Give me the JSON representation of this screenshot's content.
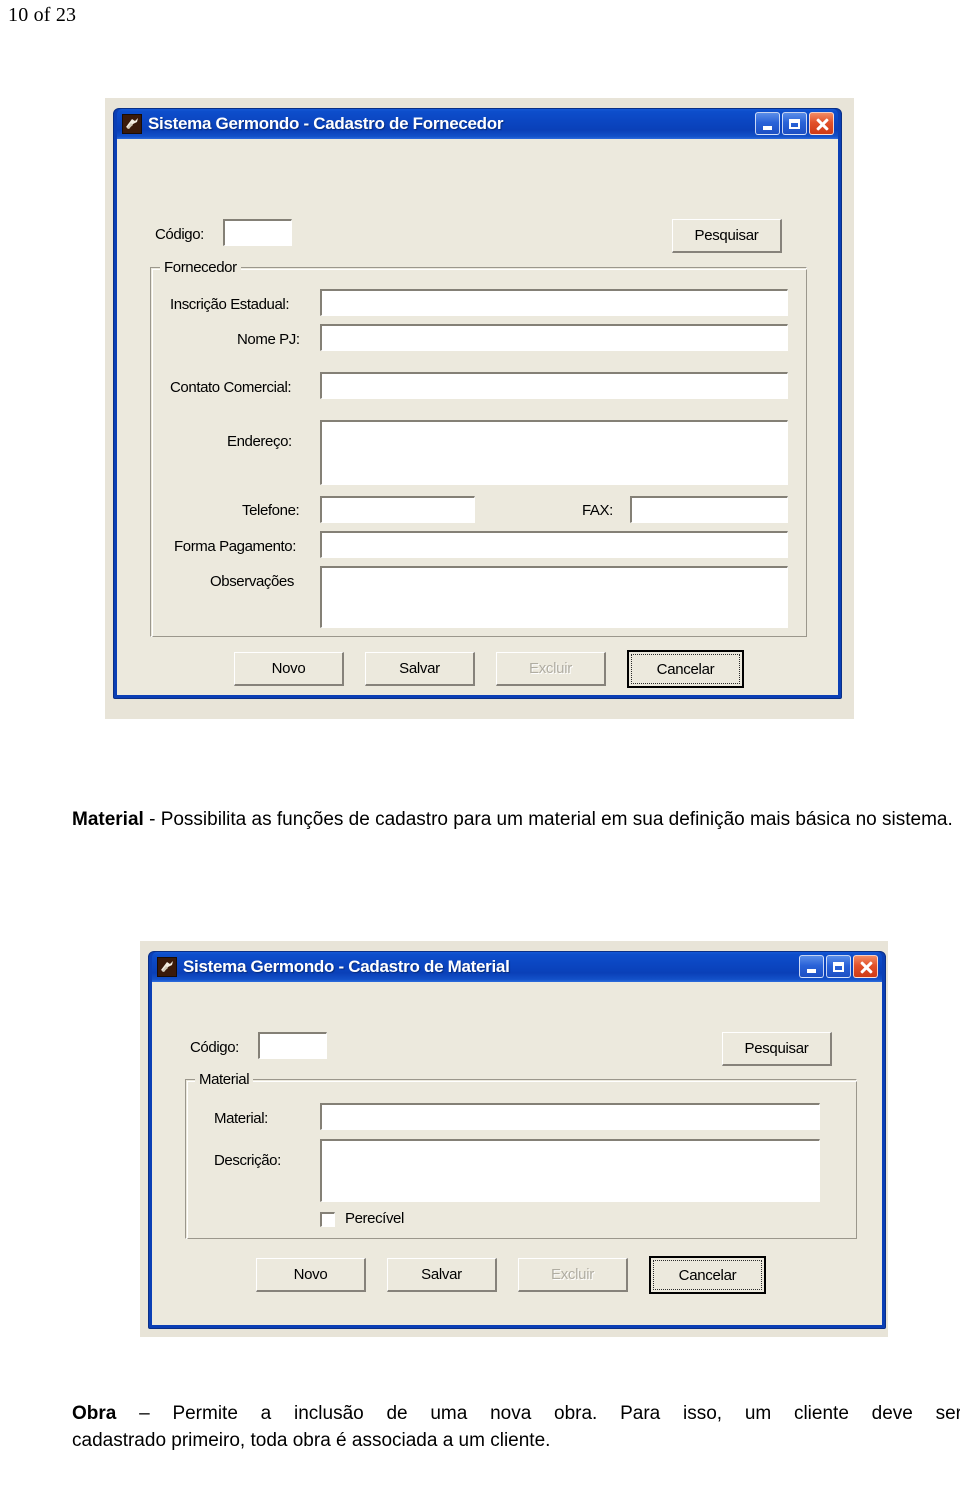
{
  "page": {
    "header": "10 of 23"
  },
  "colors": {
    "title_bar_blue": "#0b46c2",
    "window_border_blue": "#0b3fb5",
    "dialog_face": "#ece9dd",
    "backdrop_beige": "#e8e4d8",
    "close_button_red": "#e2512a",
    "field_white": "#ffffff",
    "disabled_text": "#b0ada2"
  },
  "dialog_fornecedor": {
    "title": "Sistema Germondo - Cadastro de Fornecedor",
    "app_icon": "app-icon",
    "caption": {
      "minimize": "minimize-icon",
      "maximize": "maximize-icon",
      "close": "close-icon"
    },
    "codigo": {
      "label": "Código:",
      "value": "",
      "placeholder": ""
    },
    "search_button": "Pesquisar",
    "group": {
      "title": "Fornecedor",
      "fields": [
        {
          "label": "Inscrição Estadual:",
          "value": "",
          "type": "text"
        },
        {
          "label": "Nome PJ:",
          "value": "",
          "type": "text"
        },
        {
          "label": "Contato Comercial:",
          "value": "",
          "type": "text"
        },
        {
          "label": "Endereço:",
          "value": "",
          "type": "textarea"
        },
        {
          "label": "Telefone:",
          "value": "",
          "type": "text"
        },
        {
          "label": "FAX:",
          "value": "",
          "type": "text"
        },
        {
          "label": "Forma Pagamento:",
          "value": "",
          "type": "text"
        },
        {
          "label": "Observações",
          "value": "",
          "type": "textarea"
        }
      ]
    },
    "buttons": [
      {
        "label": "Novo",
        "state": "enabled"
      },
      {
        "label": "Salvar",
        "state": "enabled"
      },
      {
        "label": "Excluir",
        "state": "disabled"
      },
      {
        "label": "Cancelar",
        "state": "default-focused"
      }
    ]
  },
  "paragraph_material": {
    "bold_lead": "Material",
    "rest": " - Possibilita as funções de cadastro para um material em sua definição mais básica no sistema."
  },
  "dialog_material": {
    "title": "Sistema Germondo - Cadastro de Material",
    "app_icon": "app-icon",
    "caption": {
      "minimize": "minimize-icon",
      "maximize": "maximize-icon",
      "close": "close-icon"
    },
    "codigo": {
      "label": "Código:",
      "value": "",
      "placeholder": ""
    },
    "search_button": "Pesquisar",
    "group": {
      "title": "Material",
      "fields": [
        {
          "label": "Material:",
          "value": "",
          "type": "text"
        },
        {
          "label": "Descrição:",
          "value": "",
          "type": "textarea"
        }
      ],
      "checkbox": {
        "label": "Perecível",
        "checked": false
      }
    },
    "buttons": [
      {
        "label": "Novo",
        "state": "enabled"
      },
      {
        "label": "Salvar",
        "state": "enabled"
      },
      {
        "label": "Excluir",
        "state": "disabled"
      },
      {
        "label": "Cancelar",
        "state": "default-focused"
      }
    ]
  },
  "paragraph_obra": {
    "bold_lead": "Obra",
    "line1": " – Permite a inclusão de uma nova obra. Para isso, um cliente deve ser",
    "line2": "cadastrado primeiro,  toda obra é associada a um cliente."
  }
}
